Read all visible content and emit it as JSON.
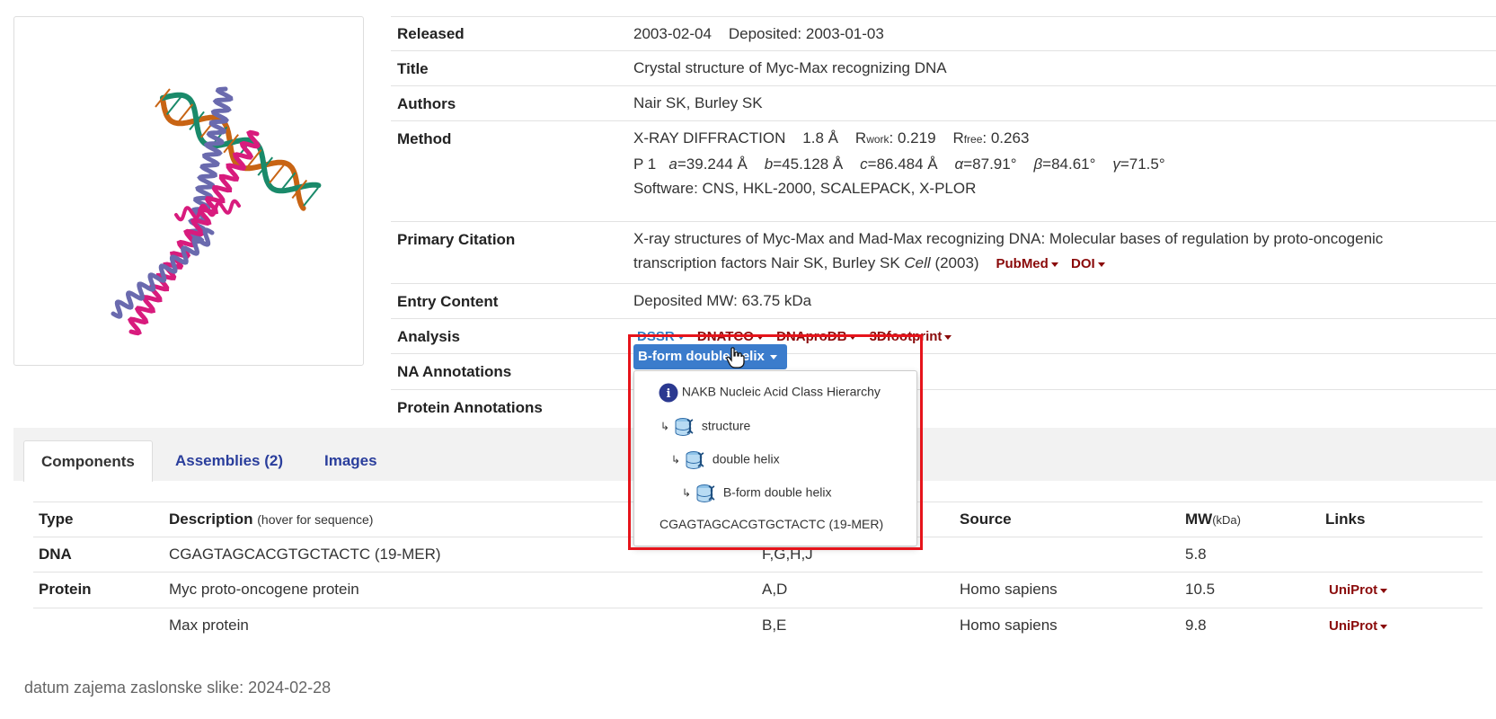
{
  "summary": {
    "released": {
      "label": "Released",
      "value": "2003-02-04",
      "deposited": "Deposited: 2003-01-03"
    },
    "title": {
      "label": "Title",
      "value": "Crystal structure of Myc-Max recognizing DNA"
    },
    "authors": {
      "label": "Authors",
      "value": "Nair SK, Burley SK"
    },
    "method": {
      "label": "Method",
      "technique": "X-RAY DIFFRACTION",
      "resolution": "1.8 Å",
      "rwork_label": "R",
      "rwork_sub": "work",
      "rwork_value": ": 0.219",
      "rfree_label": "R",
      "rfree_sub": "free",
      "rfree_value": ": 0.263",
      "space_group": "P 1",
      "a_label": "a",
      "a_value": "=39.244 Å",
      "b_label": "b",
      "b_value": "=45.128 Å",
      "c_label": "c",
      "c_value": "=86.484 Å",
      "alpha_label": "α",
      "alpha_value": "=87.91°",
      "beta_label": "β",
      "beta_value": "=84.61°",
      "gamma_label": "γ",
      "gamma_value": "=71.5°",
      "software": "Software: CNS, HKL-2000, SCALEPACK, X-PLOR"
    },
    "primary_citation": {
      "label": "Primary Citation",
      "line1": "X-ray structures of Myc-Max and Mad-Max recognizing DNA: Molecular bases of regulation by proto-oncogenic",
      "line2": "transcription factors Nair SK, Burley SK",
      "journal": "Cell",
      "year": "(2003)",
      "pubmed": "PubMed",
      "doi": "DOI"
    },
    "entry_content": {
      "label": "Entry Content",
      "value": "Deposited MW: 63.75 kDa"
    },
    "analysis": {
      "label": "Analysis",
      "links": [
        "DSSR",
        "DNATCO",
        "DNAproDB",
        "3Dfootprint"
      ]
    },
    "na_annotations": {
      "label": "NA Annotations"
    },
    "protein_annotations": {
      "label": "Protein Annotations"
    }
  },
  "na_dropdown": {
    "button_label": "B-form double helix",
    "items": {
      "info": "NAKB Nucleic Acid Class Hierarchy",
      "level1": "structure",
      "level2": "double helix",
      "level3": "B-form double helix",
      "sequence": "CGAGTAGCACGTGCTACTC (19-MER)"
    },
    "info_icon_glyph": "i",
    "tree_glyph": "↳"
  },
  "tabs": [
    "Components",
    "Assemblies (2)",
    "Images"
  ],
  "components": {
    "headers": {
      "type": "Type",
      "description": "Description",
      "description_hint": "(hover for sequence)",
      "source": "Source",
      "mw": "MW",
      "mw_unit": "(kDa)",
      "links": "Links"
    },
    "rows": [
      {
        "type": "DNA",
        "description": "CGAGTAGCACGTGCTACTC (19-MER)",
        "chains": "F,G,H,J",
        "source": "",
        "mw": "5.8",
        "link": ""
      },
      {
        "type": "Protein",
        "description": "Myc proto-oncogene protein",
        "chains": "A,D",
        "source": "Homo sapiens",
        "mw": "10.5",
        "link": "UniProt"
      },
      {
        "type": "",
        "description": "Max protein",
        "chains": "B,E",
        "source": "Homo sapiens",
        "mw": "9.8",
        "link": "UniProt"
      }
    ]
  },
  "footer_note": "datum zajema zaslonske slike: 2024-02-28",
  "colors": {
    "link_red": "#8a0a0a",
    "link_blue": "#2f7bc4",
    "tab_blue": "#2a3e9c",
    "button_blue": "#3b7ccc",
    "highlight_red": "#e6141b",
    "protein_pink": "#d81b7d",
    "protein_purple": "#6a6aae",
    "dna_orange": "#c86414",
    "dna_green": "#1a8a6a"
  }
}
